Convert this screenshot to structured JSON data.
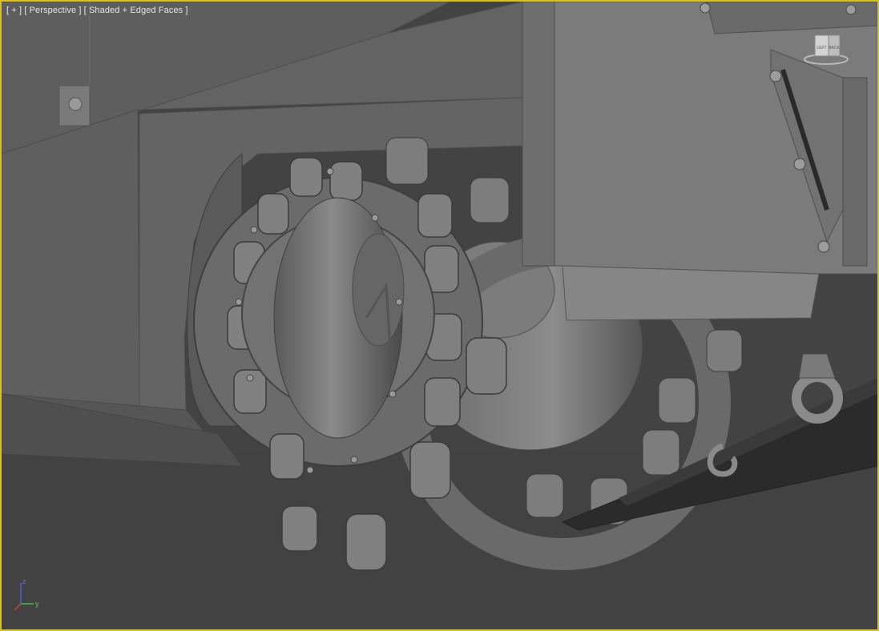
{
  "viewport": {
    "menu_label": "[ + ]",
    "view_label": "[ Perspective ]",
    "shading_label": "[ Shaded + Edged Faces ]",
    "border_color": "#d9c220",
    "background_color": "#434343"
  },
  "viewcube": {
    "left_face": "LEFT",
    "right_face": "BACK",
    "icon": "viewcube-icon"
  },
  "axis_tripod": {
    "z": "z",
    "y": "y",
    "x_color": "#c84040",
    "y_color": "#40c040",
    "z_color": "#4060e0"
  }
}
